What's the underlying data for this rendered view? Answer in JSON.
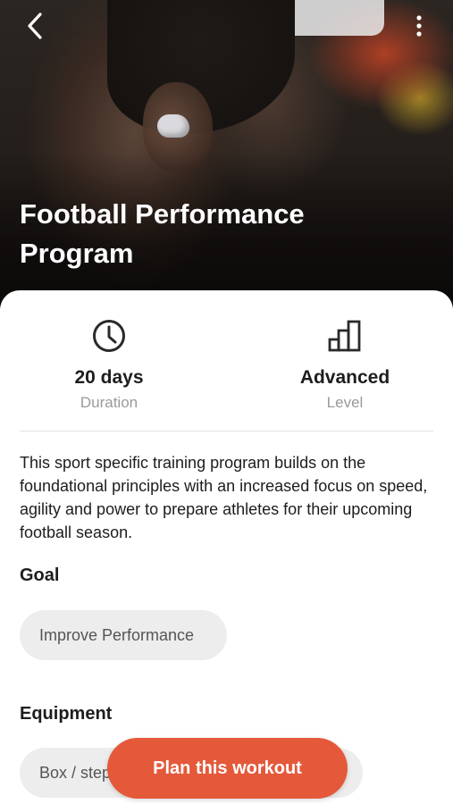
{
  "header": {
    "title_line1": "Football Performance",
    "title_line2": "Program"
  },
  "icons": {
    "back": "chevron-left-icon",
    "more": "more-vertical-icon",
    "duration": "clock-icon",
    "level": "bar-chart-icon"
  },
  "stats": {
    "duration": {
      "value": "20 days",
      "label": "Duration"
    },
    "level": {
      "value": "Advanced",
      "label": "Level"
    }
  },
  "description": "This sport specific training program builds on the foundational principles with an increased focus on speed, agility and power to prepare athletes for their upcoming football season.",
  "goal": {
    "heading": "Goal",
    "chips": [
      "Improve Performance"
    ]
  },
  "equipment": {
    "heading": "Equipment",
    "chips": [
      "Box / step"
    ]
  },
  "cta": {
    "label": "Plan this workout"
  },
  "colors": {
    "accent": "#e4593a",
    "chip_bg": "#ededed",
    "muted_text": "#9a9a9a"
  }
}
